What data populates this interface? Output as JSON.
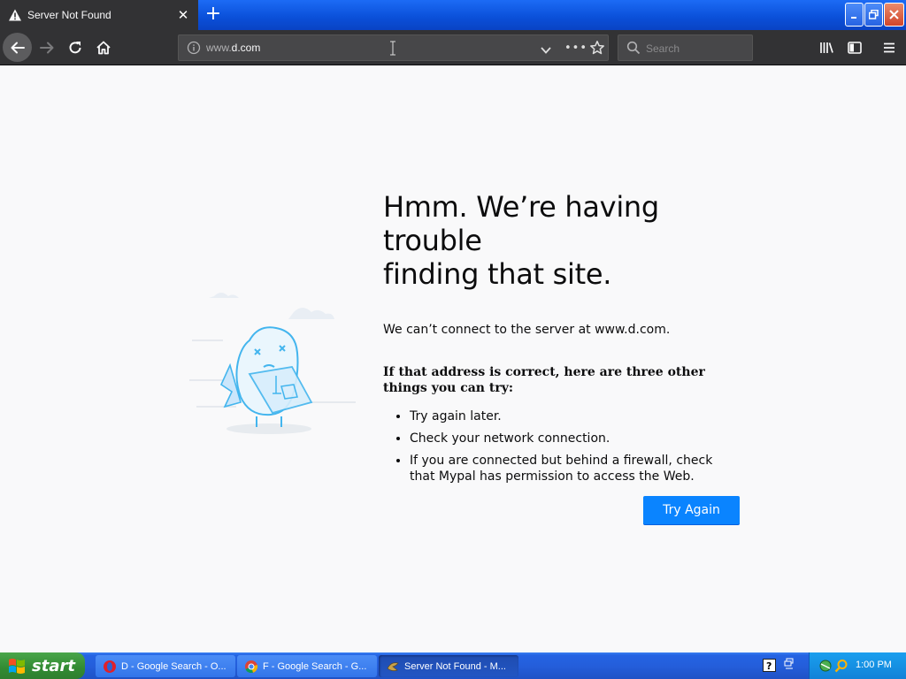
{
  "browser": {
    "tab_title": "Server Not Found",
    "url_prefix": "www.",
    "url_domain": "d.com",
    "search_placeholder": "Search"
  },
  "error_page": {
    "heading_line1": "Hmm. We’re having trouble",
    "heading_line2": "finding that site.",
    "description": "We can’t connect to the server at www.d.com.",
    "suggestions_title": "If that address is correct, here are three other things you can try:",
    "suggestions": [
      "Try again later.",
      "Check your network connection.",
      "If you are connected but behind a firewall, check that Mypal has permission to access the Web."
    ],
    "button_label": "Try Again"
  },
  "taskbar": {
    "start_label": "start",
    "tasks": [
      {
        "label": "D - Google Search - O..."
      },
      {
        "label": "F - Google Search - G..."
      },
      {
        "label": "Server Not Found - M..."
      }
    ],
    "clock": "1:00 PM"
  },
  "colors": {
    "accent": "#0a84ff",
    "toolbar": "#323234",
    "page_bg": "#f9f9fa"
  }
}
